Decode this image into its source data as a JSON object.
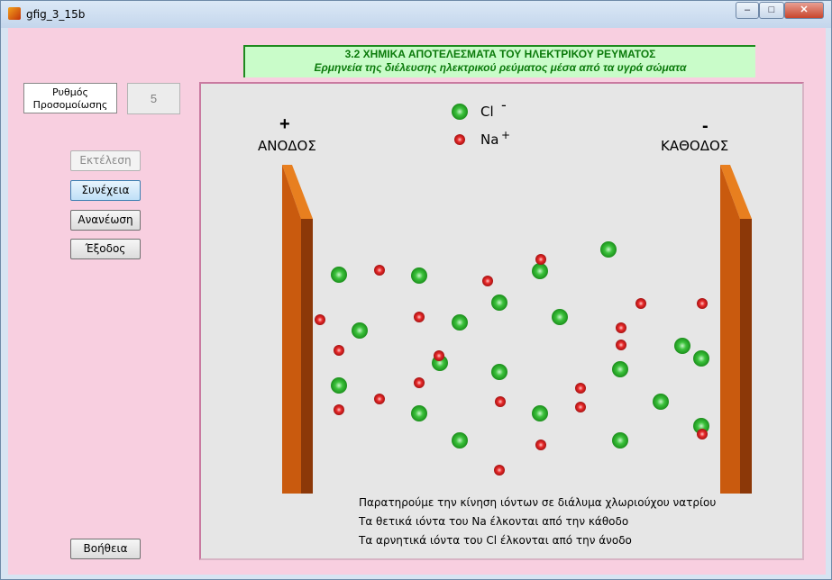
{
  "window": {
    "title": "gfig_3_15b",
    "controls": [
      "–",
      "□",
      "✕"
    ]
  },
  "header": {
    "line1": "3.2 ΧΗΜΙΚΑ  ΑΠΟΤΕΛΕΣΜΑΤΑ ΤΟΥ ΗΛΕΚΤΡΙΚΟΥ ΡΕΥΜΑΤΟΣ",
    "line2": "Ερμηνεία της διέλευσης ηλεκτρικού ρεύματος μέσα από τα υγρά σώματα"
  },
  "speed": {
    "label": "Ρυθμός Προσομοίωσης",
    "value": "5"
  },
  "buttons": {
    "run": "Εκτέλεση",
    "continue": "Συνέχεια",
    "refresh": "Ανανέωση",
    "exit": "Έξοδος",
    "help": "Βοήθεια"
  },
  "anode": {
    "sign": "+",
    "label": "ΑΝΟΔΟΣ"
  },
  "cathode": {
    "sign": "-",
    "label": "ΚΑΘΟΔΟΣ"
  },
  "legend": {
    "cl": {
      "symbol": "Cl",
      "charge": "-"
    },
    "na": {
      "symbol": "Na",
      "charge": "+"
    }
  },
  "observations": [
    "Παρατηρούμε την κίνηση ιόντων σε διάλυμα χλωριούχου νατρίου",
    "Τα θετικά ιόντα του Na έλκονται από την κάθοδο",
    "Τα αρνητικά ιόντα του Cl έλκονται από την άνοδο"
  ],
  "colors": {
    "background": "#f8cfe0",
    "electrode": "#c95a0e",
    "cl_ion": "#3cc23c",
    "na_ion": "#e82a2a",
    "header_text": "#0b7a0b"
  }
}
